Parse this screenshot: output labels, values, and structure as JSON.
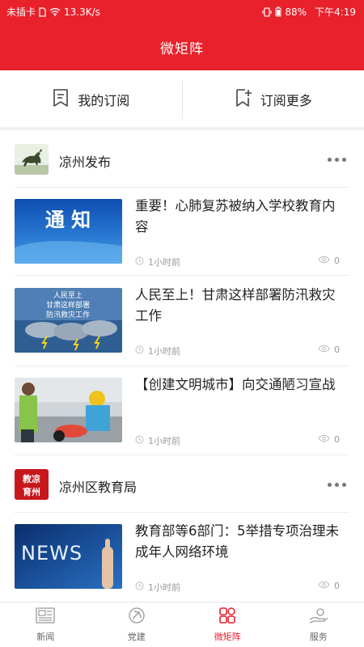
{
  "status_bar": {
    "carrier": "未插卡",
    "speed": "13.3K/s",
    "battery": "88%",
    "time": "下午4:19"
  },
  "header": {
    "title": "微矩阵"
  },
  "subscribe": {
    "my_label": "我的订阅",
    "more_label": "订阅更多"
  },
  "channels": [
    {
      "name": "凉州发布",
      "items": [
        {
          "title": "重要！心肺复苏被纳入学校教育内容",
          "thumb_text": "通 知",
          "time": "1小时前",
          "views": "0"
        },
        {
          "title": "人民至上！甘肃这样部署防汛救灾工作",
          "thumb_text_1": "人民至上",
          "thumb_text_2": "甘肃这样部署",
          "thumb_text_3": "防汛救灾工作",
          "time": "1小时前",
          "views": "0"
        },
        {
          "title": "【创建文明城市】向交通陋习宣战",
          "time": "1小时前",
          "views": "0"
        }
      ]
    },
    {
      "name": "凉州区教育局",
      "logo_text_1": "教凉",
      "logo_text_2": "育州",
      "items": [
        {
          "title": "教育部等6部门：5举措专项治理未成年人网络环境",
          "thumb_text": "NEWS",
          "time": "1小时前",
          "views": "0"
        }
      ]
    }
  ],
  "bottom_nav": {
    "items": [
      {
        "label": "新闻"
      },
      {
        "label": "党建"
      },
      {
        "label": "微矩阵"
      },
      {
        "label": "服务"
      }
    ]
  },
  "colors": {
    "brand_red": "#e8212b",
    "meta_gray": "#999999"
  }
}
